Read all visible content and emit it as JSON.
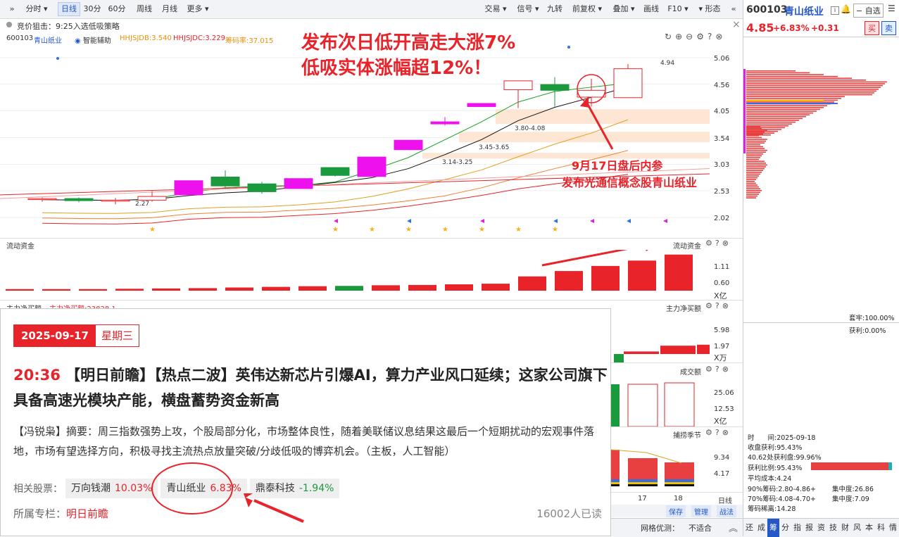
{
  "toolbar": {
    "left_items": [
      "分时",
      "日线",
      "30分",
      "60分",
      "周线",
      "月线",
      "更多"
    ],
    "right_items": [
      "交易",
      "信号",
      "九转",
      "前复权",
      "叠加",
      "画线",
      "F10",
      "形态"
    ],
    "active": "日线"
  },
  "sub_bar": {
    "text": "竞价狙击：9:25入选低吸策略"
  },
  "legend": {
    "code": "600103",
    "name": "青山纸业",
    "assist": "智能辅助",
    "hhjsjdb": "HHJSJDB:3.540",
    "hhjsjdc": "HHJSJDC:3.229",
    "chip_rate": "筹码率:37.015"
  },
  "annotations": {
    "headline1": "发布次日低开高走大涨7%",
    "headline2": "低吸实体涨幅超12%！",
    "note1": "9月17日盘后内参",
    "note2": "发布光通信概念股青山纸业"
  },
  "price_axis": [
    "5.06",
    "4.56",
    "4.05",
    "3.54",
    "3.03",
    "2.53",
    "2.02"
  ],
  "price_labels": {
    "high": "4.94",
    "low": "2.27",
    "zone1": "3.14-3.25",
    "zone2": "3.45-3.65",
    "zone3": "3.80-4.08"
  },
  "panels": {
    "flow_title": "流动资金",
    "flow_axis": [
      "1.11",
      "0.60"
    ],
    "flow_unit": "X亿",
    "net_title_left": "主力净买额",
    "net_value": "主力净买额:23828.1",
    "net_title_right": "主力净买额",
    "net_axis": [
      "5.98",
      "1.97"
    ],
    "net_unit": "X万",
    "vol_title": "成交额",
    "vol_axis": [
      "25.06",
      "12.53"
    ],
    "vol_unit": "X亿",
    "season_title": "捕捞季节",
    "season_axis": [
      "9.34",
      "4.17"
    ],
    "dates": [
      "17",
      "18"
    ],
    "daily": "日线"
  },
  "bottom_buttons": [
    "保存",
    "管理",
    "战法"
  ],
  "news": {
    "date": "2025-09-17",
    "weekday": "星期三",
    "time": "20:36",
    "title": "【明日前瞻】【热点二波】英伟达新芯片引爆AI，算力产业风口延续；这家公司旗下具备高速光模块产能，横盘蓄势资金新高",
    "summary": "【冯锐枭】摘要：周三指数强势上攻，个股局部分化，市场整体良性，随着美联储议息结果这最后一个短期扰动的宏观事件落地，市场有望选择方向，积极寻找主流热点放量突破/分歧低吸的博弈机会。（主板，人工智能）",
    "related_label": "相关股票：",
    "stocks": [
      {
        "name": "万向钱潮",
        "change": "10.03%",
        "dir": "up"
      },
      {
        "name": "青山纸业",
        "change": "6.83%",
        "dir": "up"
      },
      {
        "name": "鼎泰科技",
        "change": "-1.94%",
        "dir": "down"
      }
    ],
    "column_label": "所属专栏：",
    "column": "明日前瞻",
    "readers": "16002人已读"
  },
  "quote": {
    "code": "600103",
    "name": "青山纸业",
    "add_btn": "自选",
    "price": "4.85",
    "pct": "+6.83%",
    "chg": "+0.31",
    "buy": "买",
    "sell": "卖"
  },
  "chip_stats": {
    "lock": "套牢:100.00%",
    "profit": "获利:0.00%",
    "time": "时　　间:2025-09-18",
    "close_profit": "收盘获利:95.43%",
    "p462": "40.62处获利盘:99.96%",
    "profit_ratio": "获利比例:95.43%",
    "avg_cost": "平均成本:4.24",
    "c90": "90%筹码:2.80-4.86+",
    "c90_conc": "集中度:26.86",
    "c70": "70%筹码:4.08-4.70+",
    "c70_conc": "集中度:7.09",
    "spread": "筹码稀离:14.28"
  },
  "status_bar": {
    "grid_label": "网格优测：",
    "grid_value": "不适合"
  },
  "side_tabs": [
    "还",
    "成",
    "筹",
    "分",
    "指",
    "报",
    "资",
    "技",
    "财",
    "风",
    "本",
    "科",
    "情"
  ],
  "colors": {
    "up": "#e8232a",
    "down": "#1a9a3c",
    "magenta": "#ee11ee",
    "accent": "#2458c8"
  },
  "chart_data": {
    "type": "candlestick",
    "y_axis": [
      "5.06",
      "4.56",
      "4.05",
      "3.54",
      "3.03",
      "2.53",
      "2.02"
    ],
    "candles": [
      {
        "o": 2.38,
        "c": 2.36,
        "h": 2.4,
        "l": 2.32,
        "color": "red"
      },
      {
        "o": 2.38,
        "c": 2.34,
        "h": 2.4,
        "l": 2.31,
        "color": "green"
      },
      {
        "o": 2.35,
        "c": 2.34,
        "h": 2.39,
        "l": 2.27,
        "color": "red"
      },
      {
        "o": 2.35,
        "c": 2.42,
        "h": 2.52,
        "l": 2.32,
        "color": "red"
      },
      {
        "o": 2.45,
        "c": 2.72,
        "h": 2.72,
        "l": 2.45,
        "color": "magenta"
      },
      {
        "o": 2.79,
        "c": 2.62,
        "h": 2.92,
        "l": 2.58,
        "color": "green"
      },
      {
        "o": 2.66,
        "c": 2.51,
        "h": 2.7,
        "l": 2.47,
        "color": "green"
      },
      {
        "o": 2.57,
        "c": 2.76,
        "h": 2.76,
        "l": 2.57,
        "color": "magenta"
      },
      {
        "o": 2.97,
        "c": 2.82,
        "h": 2.97,
        "l": 2.8,
        "color": "green"
      },
      {
        "o": 2.8,
        "c": 3.17,
        "h": 3.17,
        "l": 2.8,
        "color": "magenta"
      },
      {
        "o": 3.31,
        "c": 3.49,
        "h": 3.49,
        "l": 3.31,
        "color": "magenta"
      },
      {
        "o": 3.8,
        "c": 3.84,
        "h": 3.93,
        "l": 3.77,
        "color": "magenta"
      },
      {
        "o": 4.13,
        "c": 4.19,
        "h": 4.19,
        "l": 4.13,
        "color": "magenta"
      },
      {
        "o": 4.45,
        "c": 4.62,
        "h": 4.62,
        "l": 4.1,
        "color": "red"
      },
      {
        "o": 4.55,
        "c": 4.44,
        "h": 4.69,
        "l": 4.13,
        "color": "green"
      },
      {
        "o": 4.31,
        "c": 4.44,
        "h": 4.66,
        "l": 4.13,
        "color": "red"
      },
      {
        "o": 4.3,
        "c": 4.85,
        "h": 4.94,
        "l": 4.3,
        "color": "red"
      }
    ],
    "flow_bars": [
      0.05,
      0.05,
      0.05,
      0.06,
      0.07,
      0.08,
      0.1,
      0.12,
      0.14,
      0.15,
      0.17,
      0.18,
      0.2,
      0.22,
      0.45,
      0.62,
      0.78,
      0.95,
      1.14
    ],
    "net_bars": [
      0.0,
      0.6,
      1.97,
      2.2
    ]
  }
}
